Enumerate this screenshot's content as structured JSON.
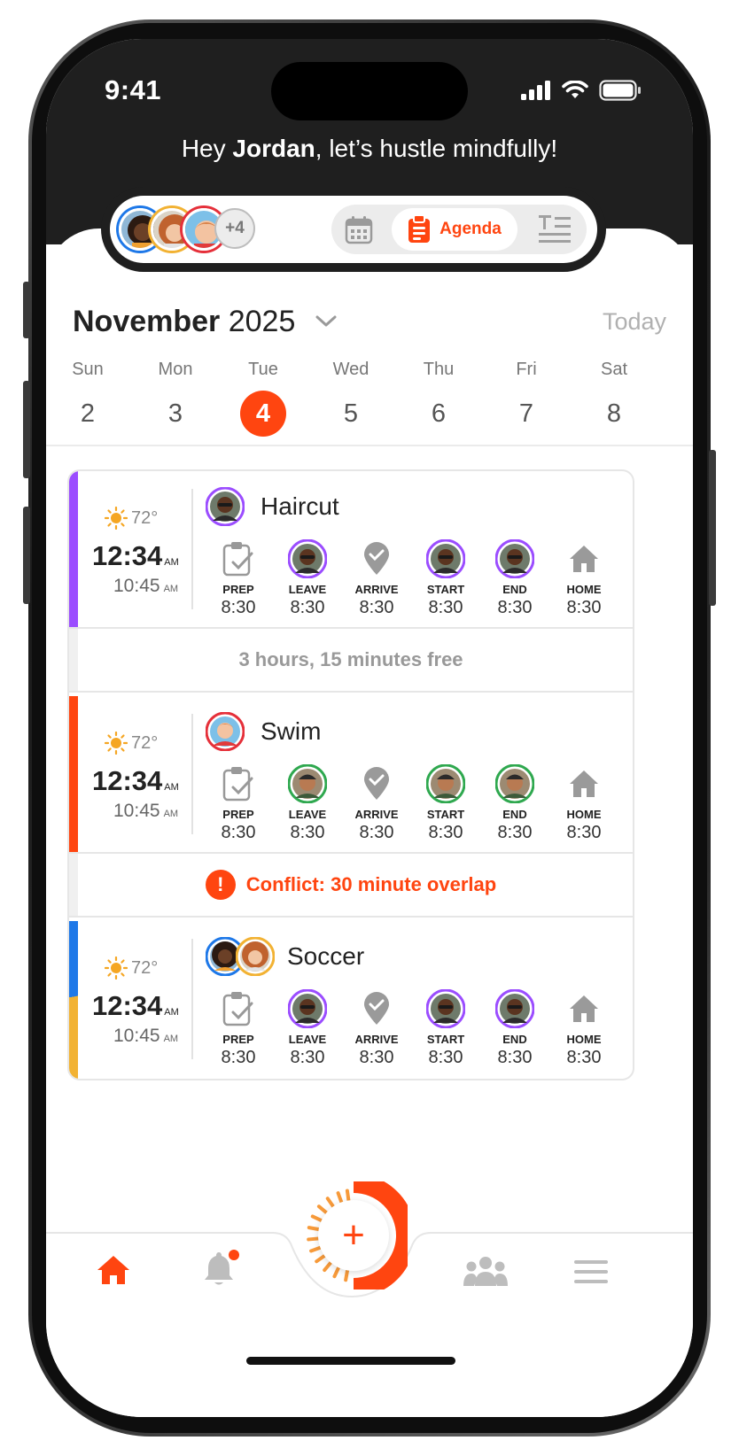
{
  "status": {
    "time": "9:41"
  },
  "greeting": {
    "prefix": "Hey ",
    "name": "Jordan",
    "suffix": ", let’s hustle mindfully!"
  },
  "household": {
    "more_count": "+4"
  },
  "view_switch": {
    "active_label": "Agenda"
  },
  "calendar": {
    "month": "November",
    "year": "2025",
    "today_label": "Today",
    "days": [
      {
        "name": "Sun",
        "date": "2"
      },
      {
        "name": "Mon",
        "date": "3"
      },
      {
        "name": "Tue",
        "date": "4",
        "selected": true
      },
      {
        "name": "Wed",
        "date": "5"
      },
      {
        "name": "Thu",
        "date": "6"
      },
      {
        "name": "Fri",
        "date": "7"
      },
      {
        "name": "Sat",
        "date": "8"
      }
    ]
  },
  "events": [
    {
      "title": "Haircut",
      "temp": "72°",
      "start": "12:34",
      "start_ampm": "AM",
      "end": "10:45",
      "end_ampm": "AM",
      "color": "#9b4dff",
      "steps": [
        {
          "label": "PREP",
          "time": "8:30"
        },
        {
          "label": "LEAVE",
          "time": "8:30"
        },
        {
          "label": "ARRIVE",
          "time": "8:30"
        },
        {
          "label": "START",
          "time": "8:30"
        },
        {
          "label": "END",
          "time": "8:30"
        },
        {
          "label": "HOME",
          "time": "8:30"
        }
      ]
    },
    {
      "title": "Swim",
      "temp": "72°",
      "start": "12:34",
      "start_ampm": "AM",
      "end": "10:45",
      "end_ampm": "AM",
      "color": "#ff4510",
      "steps": [
        {
          "label": "PREP",
          "time": "8:30"
        },
        {
          "label": "LEAVE",
          "time": "8:30"
        },
        {
          "label": "ARRIVE",
          "time": "8:30"
        },
        {
          "label": "START",
          "time": "8:30"
        },
        {
          "label": "END",
          "time": "8:30"
        },
        {
          "label": "HOME",
          "time": "8:30"
        }
      ]
    },
    {
      "title": "Soccer",
      "temp": "72°",
      "start": "12:34",
      "start_ampm": "AM",
      "end": "10:45",
      "end_ampm": "AM",
      "color": "#1e78e8",
      "steps": [
        {
          "label": "PREP",
          "time": "8:30"
        },
        {
          "label": "LEAVE",
          "time": "8:30"
        },
        {
          "label": "ARRIVE",
          "time": "8:30"
        },
        {
          "label": "START",
          "time": "8:30"
        },
        {
          "label": "END",
          "time": "8:30"
        },
        {
          "label": "HOME",
          "time": "8:30"
        }
      ]
    }
  ],
  "gaps": {
    "free": "3 hours, 15 minutes free",
    "conflict": "Conflict: 30 minute overlap",
    "conflict_mark": "!"
  },
  "fab": {
    "label": "+"
  },
  "colors": {
    "accent": "#ff4510",
    "purple": "#9b4dff",
    "green": "#2fa84f",
    "blue": "#1e78e8",
    "yellow": "#f2b233",
    "sun": "#f5a623"
  }
}
